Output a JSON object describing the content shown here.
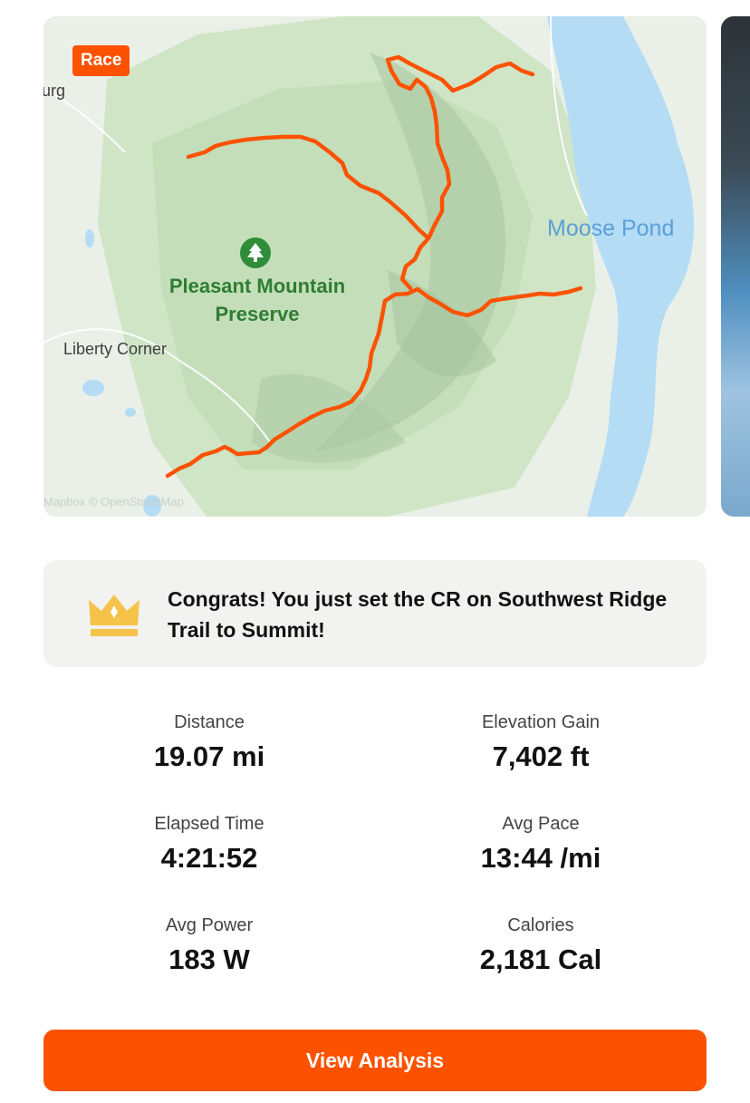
{
  "map": {
    "badge": "Race",
    "labels": {
      "town_partial": "urg",
      "park_line1": "Pleasant Mountain",
      "park_line2": "Preserve",
      "town": "Liberty Corner",
      "lake": "Moose Pond",
      "attribution": "Mapbox © OpenStreetMap"
    },
    "route_color": "#fc5200"
  },
  "achievement": {
    "icon": "crown-icon",
    "text": "Congrats! You just set the CR on Southwest Ridge Trail to Summit!"
  },
  "stats": [
    {
      "label": "Distance",
      "value": "19.07 mi"
    },
    {
      "label": "Elevation Gain",
      "value": "7,402 ft"
    },
    {
      "label": "Elapsed Time",
      "value": "4:21:52"
    },
    {
      "label": "Avg Pace",
      "value": "13:44 /mi"
    },
    {
      "label": "Avg Power",
      "value": "183 W"
    },
    {
      "label": "Calories",
      "value": "2,181 Cal"
    }
  ],
  "actions": {
    "view_analysis": "View Analysis"
  },
  "colors": {
    "brand": "#fc5200",
    "crown": "#f5c24a",
    "park_green": "#2f7d32",
    "water": "#b4dcf5"
  }
}
